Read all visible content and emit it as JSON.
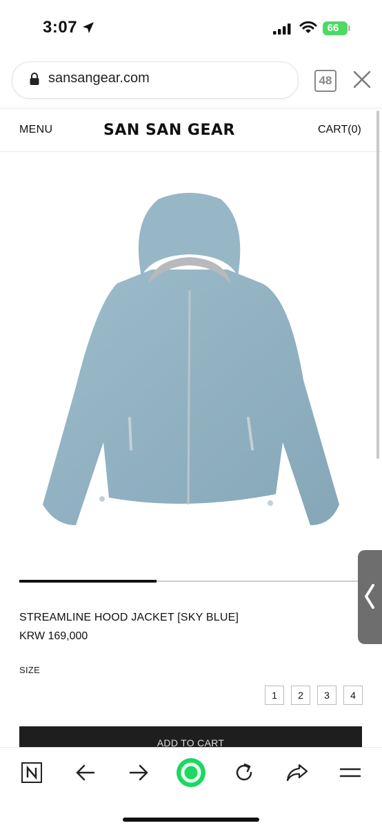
{
  "status_bar": {
    "time": "3:07",
    "battery": "66"
  },
  "browser": {
    "url": "sansangear.com",
    "tab_count": "48"
  },
  "site_header": {
    "menu": "MENU",
    "brand": "SAN SAN GEAR",
    "cart": "CART(0)"
  },
  "product": {
    "name": "STREAMLINE HOOD JACKET [SKY BLUE]",
    "price": "KRW 169,000",
    "image_color": "#8fb0c1",
    "gallery_progress": 0.4,
    "size_label": "SIZE",
    "sizes": [
      "1",
      "2",
      "3",
      "4"
    ],
    "add_to_cart": "ADD TO CART"
  },
  "toolbar": {
    "icons": [
      "naver-n-icon",
      "back-arrow-icon",
      "forward-arrow-icon",
      "green-circle-icon",
      "refresh-icon",
      "share-icon",
      "menu-lines-icon"
    ]
  }
}
